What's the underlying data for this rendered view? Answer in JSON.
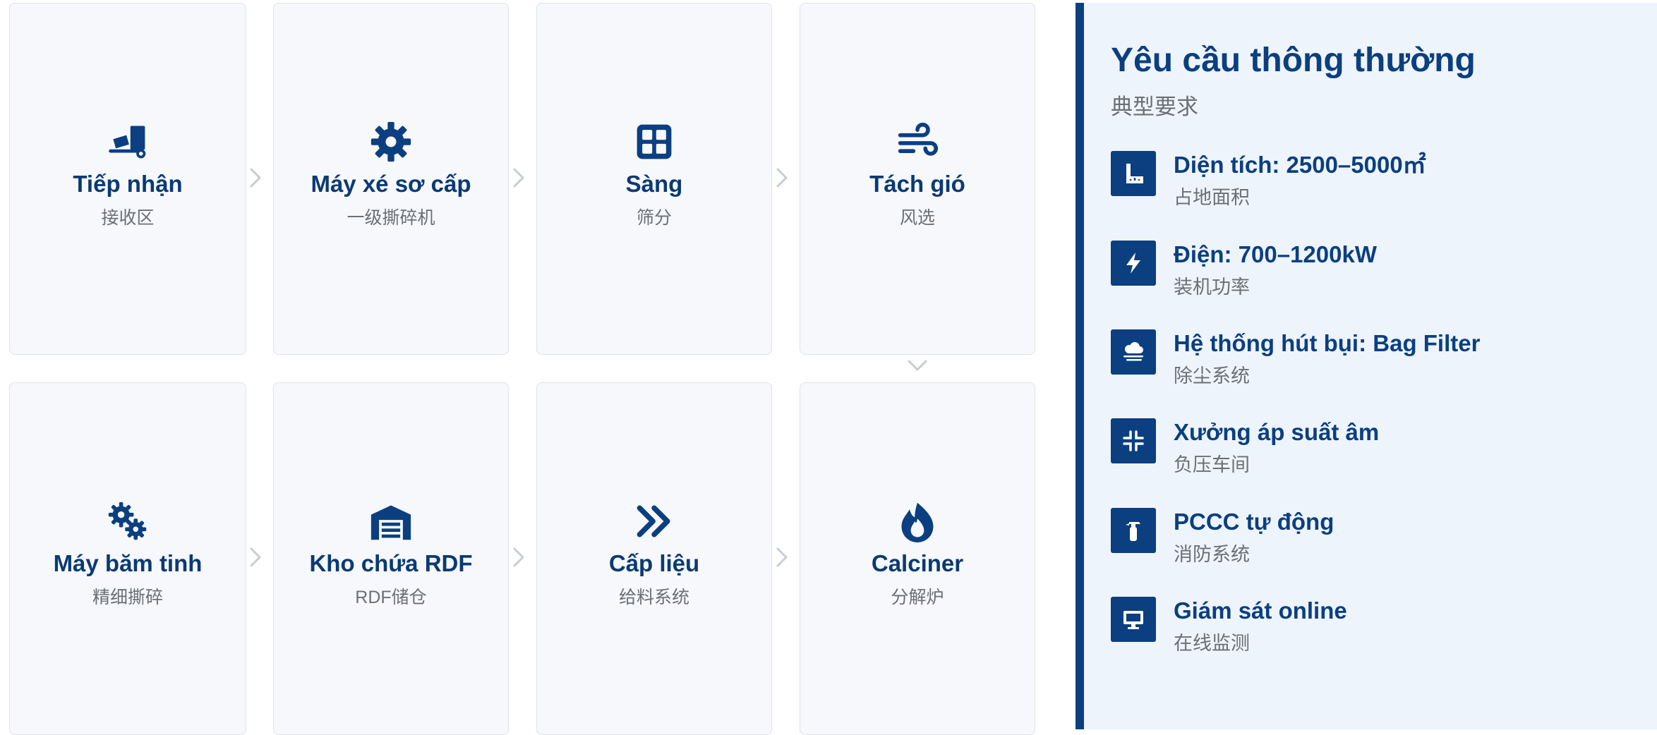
{
  "colors": {
    "accent": "#0b3f80",
    "card_background": "#f6f8fb",
    "card_border": "#dfe3e9",
    "panel_background": "#eef4fc",
    "arrow": "#c8ccd2",
    "subtitle": "#6b6f76"
  },
  "process_steps": [
    {
      "title": "Tiếp nhận",
      "subtitle": "接收区",
      "icon": "truck-ramp-icon"
    },
    {
      "title": "Máy xé sơ cấp",
      "subtitle": "一级撕碎机",
      "icon": "gear-icon"
    },
    {
      "title": "Sàng",
      "subtitle": "筛分",
      "icon": "grid-icon"
    },
    {
      "title": "Tách gió",
      "subtitle": "风选",
      "icon": "wind-icon"
    },
    {
      "title": "Máy băm tinh",
      "subtitle": "精细撕碎",
      "icon": "gears-icon"
    },
    {
      "title": "Kho chứa RDF",
      "subtitle": "RDF储仓",
      "icon": "warehouse-icon"
    },
    {
      "title": "Cấp liệu",
      "subtitle": "给料系统",
      "icon": "double-chevron-right-icon"
    },
    {
      "title": "Calciner",
      "subtitle": "分解炉",
      "icon": "fire-icon"
    }
  ],
  "requirements": {
    "title": "Yêu cầu thông thường",
    "subtitle": "典型要求",
    "items": [
      {
        "title": "Diện tích: 2500–5000㎡",
        "subtitle": "占地面积",
        "icon": "ruler-icon"
      },
      {
        "title": "Điện: 700–1200kW",
        "subtitle": "装机功率",
        "icon": "bolt-icon"
      },
      {
        "title": "Hệ thống hút bụi: Bag Filter",
        "subtitle": "除尘系统",
        "icon": "smog-icon"
      },
      {
        "title": "Xưởng áp suất âm",
        "subtitle": "负压车间",
        "icon": "compress-icon"
      },
      {
        "title": "PCCC tự động",
        "subtitle": "消防系统",
        "icon": "fire-extinguisher-icon"
      },
      {
        "title": "Giám sát online",
        "subtitle": "在线监测",
        "icon": "desktop-icon"
      }
    ]
  }
}
